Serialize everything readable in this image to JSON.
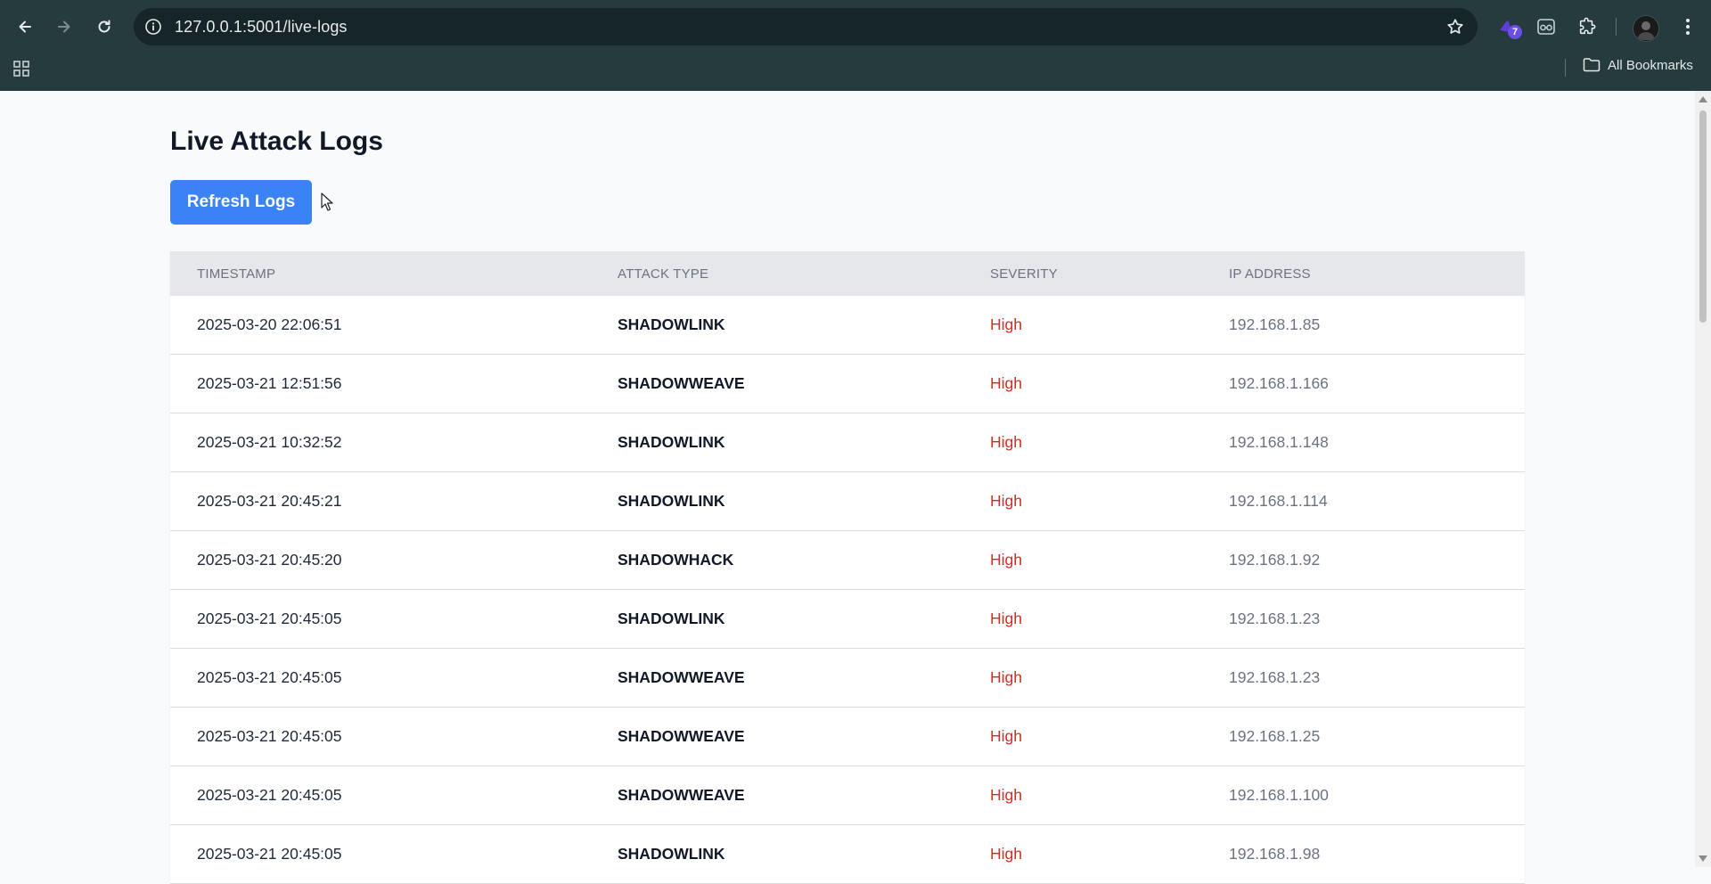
{
  "browser": {
    "url": "127.0.0.1:5001/live-logs",
    "extension_badge": "7",
    "bookmarks_label": "All Bookmarks"
  },
  "page": {
    "title": "Live Attack Logs",
    "refresh_label": "Refresh Logs"
  },
  "table": {
    "headers": [
      "TIMESTAMP",
      "ATTACK TYPE",
      "SEVERITY",
      "IP ADDRESS"
    ],
    "rows": [
      {
        "timestamp": "2025-03-20 22:06:51",
        "type": "SHADOWLINK",
        "severity": "High",
        "ip": "192.168.1.85"
      },
      {
        "timestamp": "2025-03-21 12:51:56",
        "type": "SHADOWWEAVE",
        "severity": "High",
        "ip": "192.168.1.166"
      },
      {
        "timestamp": "2025-03-21 10:32:52",
        "type": "SHADOWLINK",
        "severity": "High",
        "ip": "192.168.1.148"
      },
      {
        "timestamp": "2025-03-21 20:45:21",
        "type": "SHADOWLINK",
        "severity": "High",
        "ip": "192.168.1.114"
      },
      {
        "timestamp": "2025-03-21 20:45:20",
        "type": "SHADOWHACK",
        "severity": "High",
        "ip": "192.168.1.92"
      },
      {
        "timestamp": "2025-03-21 20:45:05",
        "type": "SHADOWLINK",
        "severity": "High",
        "ip": "192.168.1.23"
      },
      {
        "timestamp": "2025-03-21 20:45:05",
        "type": "SHADOWWEAVE",
        "severity": "High",
        "ip": "192.168.1.23"
      },
      {
        "timestamp": "2025-03-21 20:45:05",
        "type": "SHADOWWEAVE",
        "severity": "High",
        "ip": "192.168.1.25"
      },
      {
        "timestamp": "2025-03-21 20:45:05",
        "type": "SHADOWWEAVE",
        "severity": "High",
        "ip": "192.168.1.100"
      },
      {
        "timestamp": "2025-03-21 20:45:05",
        "type": "SHADOWLINK",
        "severity": "High",
        "ip": "192.168.1.98"
      }
    ]
  },
  "colors": {
    "chrome": "#253b3e",
    "button": "#3b82f6",
    "severity_high": "#dc2626"
  }
}
